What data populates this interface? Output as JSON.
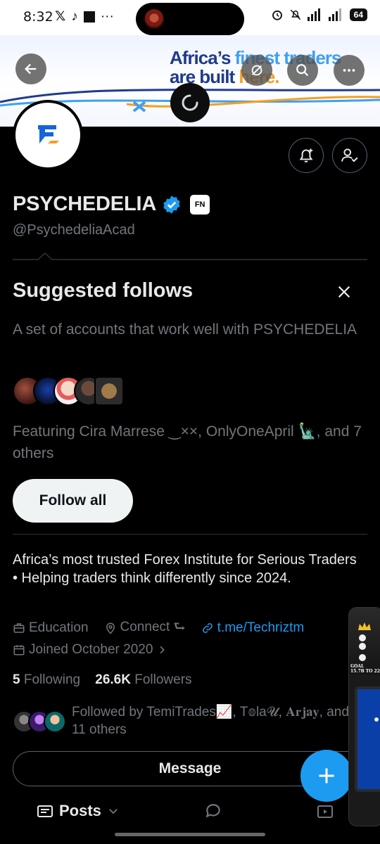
{
  "status_bar": {
    "time": "8:32",
    "left_icons": [
      "x-logo-icon",
      "tiktok-icon",
      "square-icon",
      "more-dots-icon"
    ],
    "right_icons": [
      "alarm-icon",
      "mute-icon",
      "signal-icon",
      "signal-4g-icon"
    ],
    "battery": "64"
  },
  "banner": {
    "line1_main": "Africa’s ",
    "line1_accent": "finest traders",
    "line2_main": "are built ",
    "line2_accent": "here."
  },
  "profile": {
    "display_name": "PSYCHEDELIA",
    "affiliate_badge": "FN",
    "handle": "@PsychedeliaAcad",
    "bio": "Africa’s most trusted Forex Institute for Serious Traders • Helping traders think differently since 2024.",
    "category": "Education",
    "location": "Connect ⮑",
    "link": "t.me/Techriztm",
    "joined": "Joined October 2020",
    "following_count": "5",
    "following_label": "Following",
    "followers_count": "26.6K",
    "followers_label": "Followers",
    "followed_by": "Followed by TemiTrades📈, T𝕠la𝓤, 𝐀𝐫𝐣𝐚𝐲, and 11 others"
  },
  "suggested": {
    "title": "Suggested follows",
    "description": "A set of accounts that work well with PSYCHEDELIA",
    "featuring": "Featuring Cira Marrese ‿××, OnlyOneApril 🗽, and 7 others",
    "follow_all": "Follow all"
  },
  "actions": {
    "message": "Message"
  },
  "tabs": {
    "posts": "Posts"
  },
  "game_overlay": {
    "goal_line1": "GOAL",
    "goal_line2": "15.7B TO 22"
  },
  "colors": {
    "accent": "#1d9bf0",
    "muted": "#71767b",
    "text": "#e7e9ea",
    "background": "#000000"
  }
}
